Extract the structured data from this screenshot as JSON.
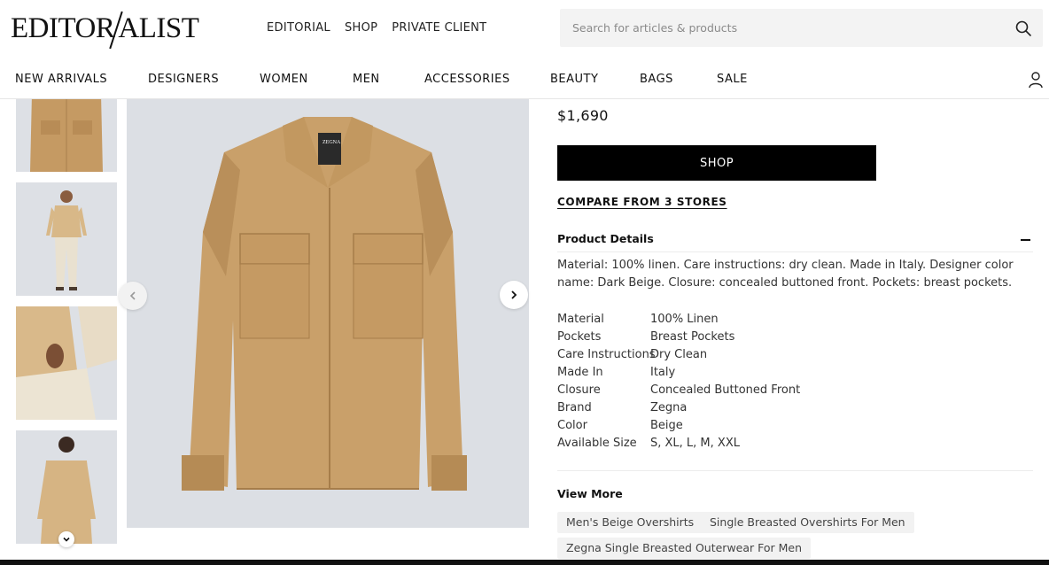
{
  "header": {
    "logo": "EDITORIALIST",
    "nav": [
      "EDITORIAL",
      "SHOP",
      "PRIVATE CLIENT"
    ],
    "search_placeholder": "Search for articles & products"
  },
  "main_nav": [
    "NEW ARRIVALS",
    "DESIGNERS",
    "WOMEN",
    "MEN",
    "ACCESSORIES",
    "BEAUTY",
    "BAGS",
    "SALE"
  ],
  "gallery": {
    "thumbnails": [
      "front-detail",
      "full-body",
      "pocket-detail",
      "back-view"
    ]
  },
  "product": {
    "price": "$1,690",
    "shop_label": "SHOP",
    "compare_label": "COMPARE FROM 3 STORES",
    "details_title": "Product Details",
    "description": "Material: 100% linen. Care instructions: dry clean. Made in Italy. Designer color name: Dark Beige. Closure: concealed buttoned front. Pockets: breast pockets.",
    "specs": [
      {
        "key": "Material",
        "value": "100% Linen"
      },
      {
        "key": "Pockets",
        "value": "Breast Pockets"
      },
      {
        "key": "Care Instructions",
        "value": "Dry Clean"
      },
      {
        "key": "Made In",
        "value": "Italy"
      },
      {
        "key": "Closure",
        "value": "Concealed Buttoned Front"
      },
      {
        "key": "Brand",
        "value": "Zegna"
      },
      {
        "key": "Color",
        "value": "Beige"
      },
      {
        "key": "Available Size",
        "value": "S, XL, L, M, XXL"
      }
    ],
    "view_more_title": "View More",
    "tags": [
      "Men's Beige Overshirts",
      "Single Breasted Overshirts For Men",
      "Zegna Single Breasted Outerwear For Men"
    ],
    "label_brand": "ZEGNA"
  },
  "colors": {
    "jacket": "#c9a06a",
    "background": "#dcdfe4",
    "accent": "#000000"
  }
}
